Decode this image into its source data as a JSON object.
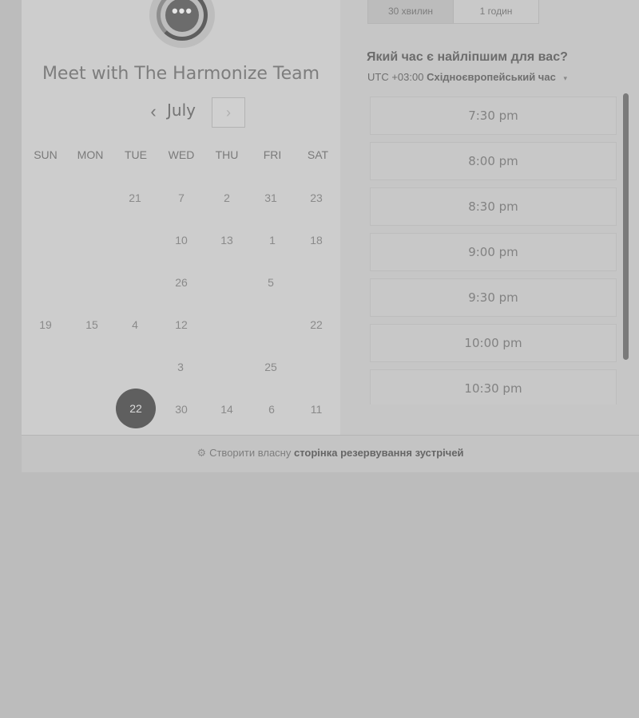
{
  "header": {
    "title": "Meet with The Harmonize Team",
    "logo_glyph": "•••"
  },
  "calendar": {
    "month": "July",
    "prev_glyph": "‹",
    "next_glyph": "›",
    "weekdays": [
      "SUN",
      "MON",
      "TUE",
      "WED",
      "THU",
      "FRI",
      "SAT"
    ],
    "rows": [
      [
        "",
        "",
        "21",
        "7",
        "2",
        "31",
        "23"
      ],
      [
        "",
        "",
        "",
        "10",
        "13",
        "1",
        "18"
      ],
      [
        "",
        "",
        "",
        "26",
        "",
        "5",
        ""
      ],
      [
        "19",
        "15",
        "4",
        "12",
        "",
        "",
        "22"
      ],
      [
        "",
        "",
        "",
        "3",
        "",
        "25",
        ""
      ],
      [
        "",
        "",
        "22",
        "30",
        "14",
        "6",
        "11"
      ]
    ],
    "selected": "22"
  },
  "durations": {
    "option_30": "30 хвилин",
    "option_60": "1 годин"
  },
  "time_picker": {
    "heading": "Який час є найліпшим для вас?",
    "tz_offset": "UTC +03:00",
    "tz_name": "Східноєвропейський час",
    "chevron": "▾",
    "slots": [
      "7:30 pm",
      "8:00 pm",
      "8:30 pm",
      "9:00 pm",
      "9:30 pm",
      "10:00 pm",
      "10:30 pm"
    ]
  },
  "footer": {
    "sprocket_glyph": "⚙",
    "prefix": "Створити власну",
    "link": "сторінка резервування зустрічей"
  }
}
